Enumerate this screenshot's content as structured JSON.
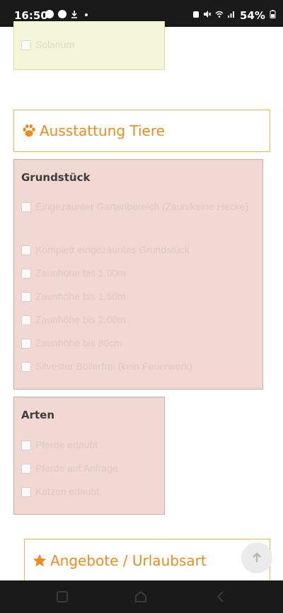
{
  "status_bar": {
    "time": "16:50",
    "battery": "54%"
  },
  "top_panel": {
    "items": [
      {
        "label": "Solarium"
      }
    ]
  },
  "section_tiere": {
    "title": "Ausstattung Tiere",
    "icon": "paw-icon"
  },
  "grundstueck": {
    "title": "Grundstück",
    "items": [
      {
        "label": "Eingezäunter Gartenbereich (Zaun/keine Hecke)"
      },
      {
        "label": "Komplett eingezäuntes Grundstück"
      },
      {
        "label": "Zaunhöhe bis 1,00m"
      },
      {
        "label": "Zaunhöhe bis 1,50m"
      },
      {
        "label": "Zaunhöhe bis 2,00m"
      },
      {
        "label": "Zaunhöhe bis 80cm"
      },
      {
        "label": "Silvester Böllerfrei (kein Feuerwerk)"
      }
    ]
  },
  "arten": {
    "title": "Arten",
    "items": [
      {
        "label": "Pferde erlaubt"
      },
      {
        "label": "Pferde auf Anfrage"
      },
      {
        "label": "Katzen erlaubt"
      }
    ]
  },
  "section_angebote": {
    "title": "Angebote / Urlaubsart",
    "icon": "star-icon"
  },
  "colors": {
    "accent": "#ef8c1d",
    "panel_pink": "#f1d8d3",
    "panel_yellow": "#f3f6d9"
  }
}
